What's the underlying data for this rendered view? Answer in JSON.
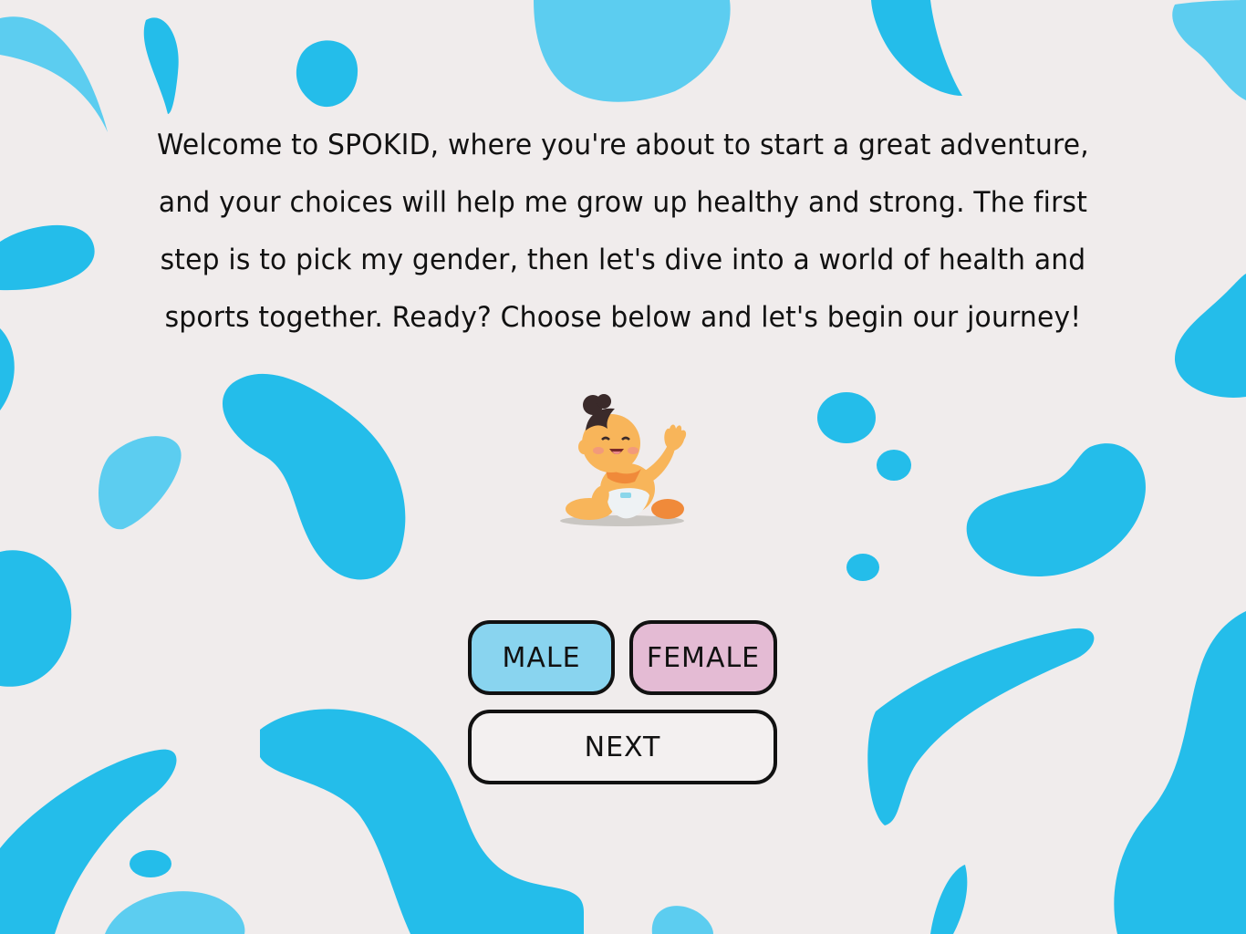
{
  "intro": {
    "text": "Welcome to SPOKID, where you're about to start a great adventure, and your choices will help me grow up healthy and strong. The first step is to pick my gender, then let's dive into a world of health and sports together. Ready? Choose below and let's begin our journey!"
  },
  "gender": {
    "male_label": "MALE",
    "female_label": "FEMALE"
  },
  "actions": {
    "next_label": "NEXT"
  },
  "colors": {
    "background": "#f0ecec",
    "blob_primary": "#24bdea",
    "blob_light": "#5ccdf0",
    "male_button": "#89d4ef",
    "female_button": "#e4bbd4",
    "border": "#111111"
  },
  "illustration": {
    "icon": "baby-waving-icon"
  }
}
